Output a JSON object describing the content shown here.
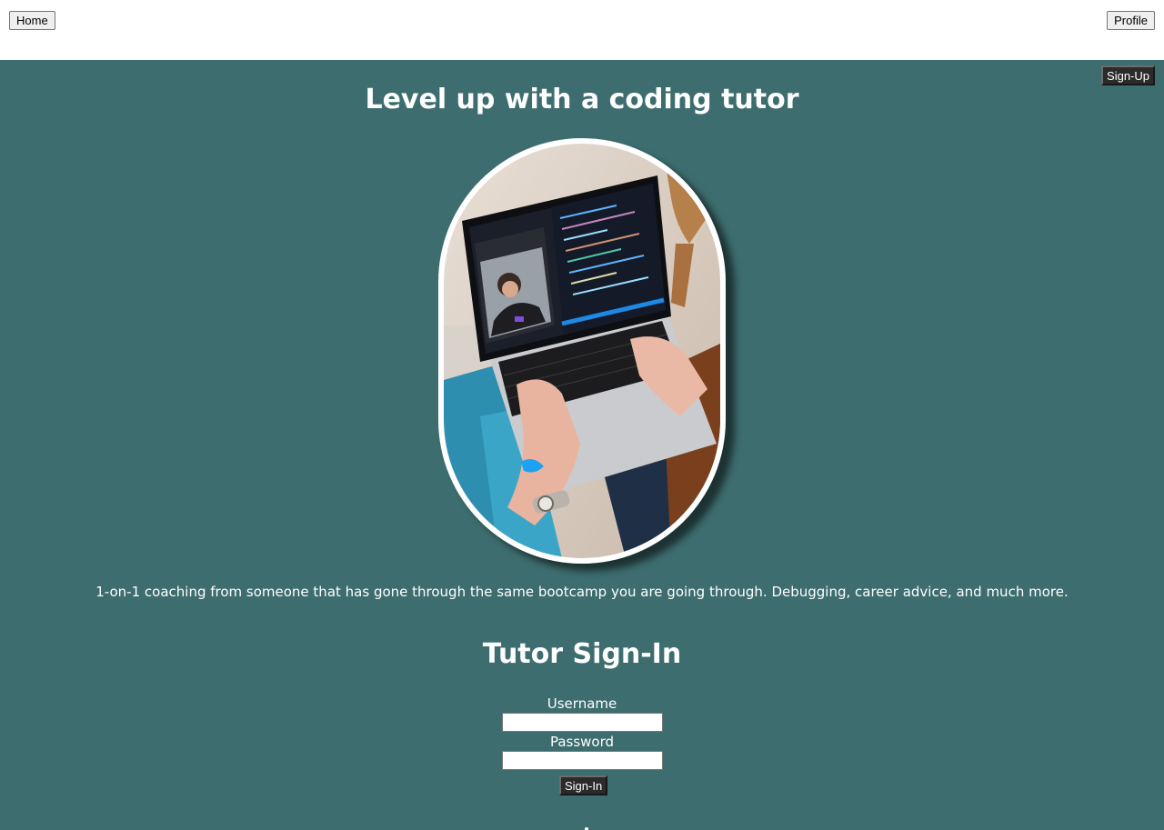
{
  "nav": {
    "home_label": "Home",
    "profile_label": "Profile"
  },
  "header": {
    "signup_label": "Sign-Up"
  },
  "hero": {
    "title": "Level up with a coding tutor",
    "tagline": "1-on-1 coaching from someone that has gone through the same bootcamp you are going through. Debugging, career advice, and much more."
  },
  "signin": {
    "title": "Tutor Sign-In",
    "username_label": "Username",
    "username_value": "",
    "password_label": "Password",
    "password_value": "",
    "submit_label": "Sign-In"
  },
  "colors": {
    "page_background": "#3d6d6f",
    "topbar_background": "#ffffff",
    "button_dark": "#2b2b2b",
    "text_light": "#ffffff"
  }
}
